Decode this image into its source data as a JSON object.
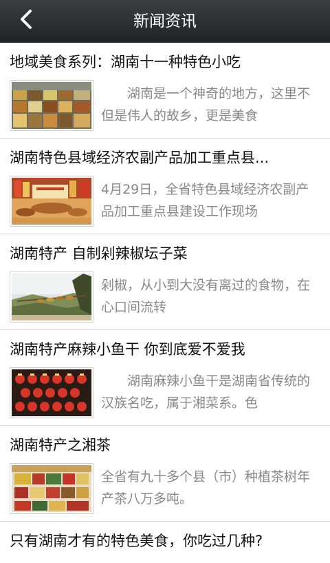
{
  "header": {
    "title": "新闻资讯",
    "back_icon": "chevron-left-icon"
  },
  "colors": {
    "header_bg": "#2c2f33",
    "title_text": "#111111",
    "summary_text": "#888888",
    "divider": "#d8d8d8"
  },
  "news": [
    {
      "title": "地域美食系列：湖南十一种特色小吃",
      "summary": "湖南是一个神奇的地方，这里不但是伟人的故乡，更是美食",
      "image": "snack-market-image"
    },
    {
      "title": "湖南特色县域经济农副产品加工重点县...",
      "summary": "4月29日，全省特色县域经济农副产品加工重点县建设工作现场",
      "image": "product-exhibition-image"
    },
    {
      "title": "湖南特产 自制剁辣椒坛子菜",
      "summary": "剁椒，从小到大没有离过的食物，在心口间流转",
      "image": "chili-drying-image"
    },
    {
      "title": "湖南特产麻辣小鱼干 你到底爱不爱我",
      "summary": "湖南麻辣小鱼干是湖南省传统的汉族名吃，属于湘菜系。色",
      "image": "fish-jars-image"
    },
    {
      "title": "湖南特产之湘茶",
      "summary": "全省有九十多个县（市）种植茶树年产茶八万多吨。",
      "image": "tea-shelf-image"
    },
    {
      "title": "只有湖南才有的特色美食，你吃过几种?"
    }
  ]
}
